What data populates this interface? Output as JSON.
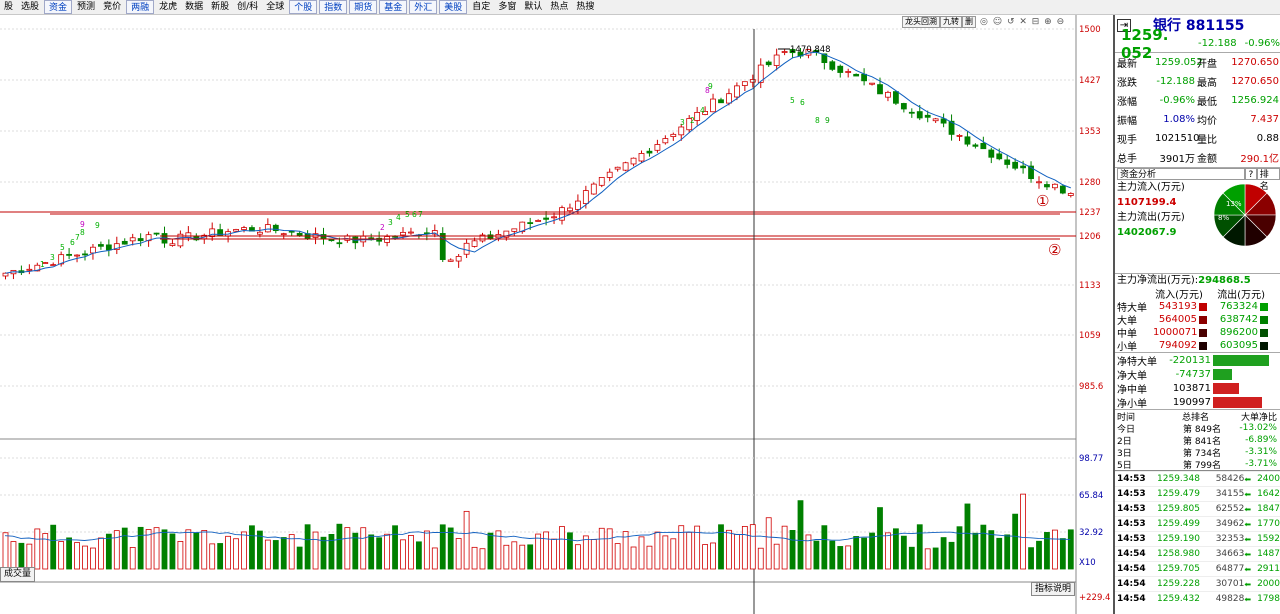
{
  "toolbar": {
    "items": [
      "股",
      "选股",
      "资金",
      "预测",
      "竞价",
      "两融",
      "龙虎",
      "数据",
      "新股",
      "创/科",
      "全球",
      "个股",
      "指数",
      "期货",
      "基金",
      "外汇",
      "美股",
      "自定",
      "多窗",
      "默认",
      "热点",
      "热搜"
    ]
  },
  "chart_header": {
    "buttons": [
      "龙头回溯",
      "九转",
      "删"
    ],
    "icons": "◎ ☺ ↺ ✕ ⊟ ⊕ ⊖"
  },
  "chart_data": [
    {
      "type": "candlestick",
      "y_tick_labels": [
        "1500",
        "1427",
        "1353",
        "1280",
        "1237",
        "1206",
        "1133",
        "1059",
        "985.6"
      ],
      "annotations": [
        "1470.848"
      ],
      "markers": [
        "①",
        "②"
      ],
      "lines": [
        {
          "level": 1237,
          "color": "#c00000"
        },
        {
          "level": 1206,
          "color": "#c00000"
        }
      ],
      "td_labels": [
        "9",
        "1",
        "3",
        "5",
        "6",
        "7",
        "8",
        "9",
        "2",
        "3",
        "4",
        "5",
        "6",
        "7",
        "8",
        "9",
        "2",
        "3",
        "4",
        "5",
        "6",
        "8",
        "9"
      ]
    },
    {
      "type": "bar",
      "y_tick_labels": [
        "98.77",
        "65.84",
        "32.92",
        "X10"
      ],
      "ylim": [
        0,
        98.77
      ],
      "xlabel": "成交量"
    },
    {
      "type": "line",
      "y_tick_labels": [
        "+229.4"
      ]
    }
  ],
  "indicator_button": "指标说明",
  "panel": {
    "name": "银行",
    "code": "881155",
    "price": "1259. 052",
    "change": "-12.188",
    "pct": "-0.96%",
    "quotes": [
      {
        "l": "最新",
        "v": "1259.052",
        "l2": "开盘",
        "v2": "1270.650"
      },
      {
        "l": "涨跌",
        "v": "-12.188",
        "l2": "最高",
        "v2": "1270.650"
      },
      {
        "l": "涨幅",
        "v": "-0.96%",
        "l2": "最低",
        "v2": "1256.924"
      },
      {
        "l": "振幅",
        "v": "1.08%",
        "l2": "均价",
        "v2": "7.437"
      },
      {
        "l": "现手",
        "v": "1021510",
        "l2": "量比",
        "v2": "0.88"
      },
      {
        "l": "总手",
        "v": "3901万",
        "l2": "金额",
        "v2": "290.1亿"
      }
    ],
    "fund": {
      "title": "资金分析",
      "q": "?",
      "rank_btn": "排名",
      "inflow_label": "主力流入(万元)",
      "inflow": "1107199.4",
      "outflow_label": "主力流出(万元)",
      "outflow": "1402067.9",
      "net_label": "主力净流出(万元):",
      "net": "294868.5",
      "pie_labels": [
        "13%",
        "8%"
      ]
    },
    "flow_header": [
      "流入(万元)",
      "流出(万元)"
    ],
    "flows": [
      {
        "n": "特大单",
        "in": "543193",
        "out": "763324",
        "c": "#c00000"
      },
      {
        "n": "大单",
        "in": "564005",
        "out": "638742",
        "c": "#8b0000"
      },
      {
        "n": "中单",
        "in": "1000071",
        "out": "896200",
        "c": "#4a0000"
      },
      {
        "n": "小单",
        "in": "794092",
        "out": "603095",
        "c": "#200000"
      }
    ],
    "nets": [
      {
        "n": "净特大单",
        "v": "-220131",
        "frac": 1.0
      },
      {
        "n": "净大单",
        "v": "-74737",
        "frac": 0.34
      },
      {
        "n": "净中单",
        "v": "103871",
        "frac": 0.47
      },
      {
        "n": "净小单",
        "v": "190997",
        "frac": 0.87
      }
    ],
    "rank_header": [
      "时间",
      "总排名",
      "大单净比"
    ],
    "ranks": [
      {
        "t": "今日",
        "r": "第 849名",
        "p": "-13.02%"
      },
      {
        "t": "2日",
        "r": "第 841名",
        "p": "-6.89%"
      },
      {
        "t": "3日",
        "r": "第 734名",
        "p": "-3.31%"
      },
      {
        "t": "5日",
        "r": "第 799名",
        "p": "-3.71%"
      }
    ],
    "ticks": [
      {
        "t": "14:53",
        "p": "1259.348",
        "v": "58426",
        "x": "2400"
      },
      {
        "t": "14:53",
        "p": "1259.479",
        "v": "34155",
        "x": "1642"
      },
      {
        "t": "14:53",
        "p": "1259.805",
        "v": "62552",
        "x": "1847"
      },
      {
        "t": "14:53",
        "p": "1259.499",
        "v": "34962",
        "x": "1770"
      },
      {
        "t": "14:53",
        "p": "1259.190",
        "v": "32353",
        "x": "1592"
      },
      {
        "t": "14:54",
        "p": "1258.980",
        "v": "34663",
        "x": "1487"
      },
      {
        "t": "14:54",
        "p": "1259.705",
        "v": "64877",
        "x": "2911"
      },
      {
        "t": "14:54",
        "p": "1259.228",
        "v": "30701",
        "x": "2000"
      },
      {
        "t": "14:54",
        "p": "1259.432",
        "v": "49828",
        "x": "1798"
      }
    ]
  }
}
